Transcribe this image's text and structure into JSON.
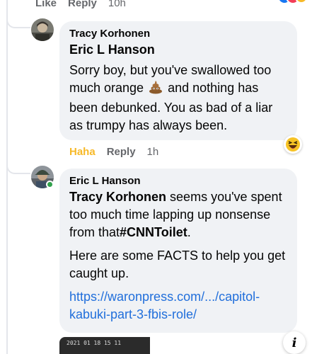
{
  "top_actions": {
    "like": "Like",
    "reply": "Reply",
    "time": "10h"
  },
  "comments": [
    {
      "author": "Tracy Korhonen",
      "mention": "Eric L Hanson",
      "text_before_emoji": "Sorry boy, but you've swallowed too much orange",
      "emoji_icon": "poop-emoji",
      "text_after_emoji": "and nothing has been debunked. You as bad of a liar as trumpy has always been.",
      "reaction": "haha-emoji",
      "actions": {
        "react": "Haha",
        "reply": "Reply",
        "time": "1h"
      }
    },
    {
      "author": "Eric L Hanson",
      "mention": "Tracy Korhonen",
      "text_1a": "seems you've spent too much time lapping up nonsense from that",
      "hashtag": "#CNNToilet",
      "text_1b": ".",
      "text_2": "Here are some FACTS to help you get caught up.",
      "link": "https://waronpress.com/.../capitol-kabuki-part-3-fbis-role/",
      "preview_text": "2021 01 18 15 11"
    }
  ],
  "colors": {
    "link": "#216fdb",
    "haha": "#f7b928",
    "bubble": "#f0f2f5",
    "online": "#31a24c"
  }
}
